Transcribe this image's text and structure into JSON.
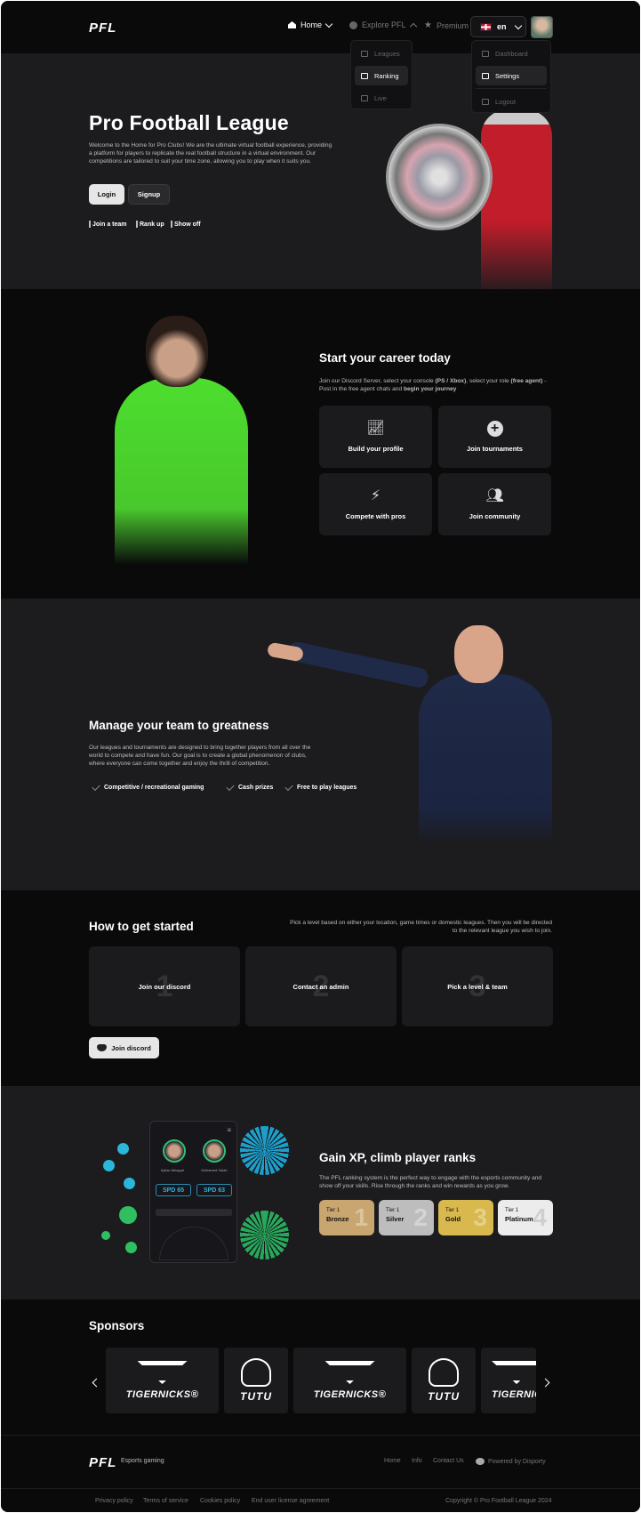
{
  "header": {
    "logo": "PFL",
    "nav": {
      "home": "Home",
      "explore": "Explore PFL",
      "premium": "Premium",
      "lang": "en"
    },
    "explore_menu": [
      "Leagues",
      "Ranking",
      "Live"
    ],
    "user_menu": [
      "Dashboard",
      "Settings",
      "Logout"
    ]
  },
  "hero": {
    "title": "Pro Football League",
    "description": "Welcome to the Home for Pro Clubs! We are the ultimate virtual football experience, providing a platform for players to replicate the real football structure in a virtual environment. Our competitions are tailored to suit your time zone, allowing you to play when it suits you.",
    "login": "Login",
    "signup": "Signup",
    "tags": [
      "Join a team",
      "Rank up",
      "Show off"
    ]
  },
  "career": {
    "title": "Start your career today",
    "text_a": "Join our Discord Server, select your console ",
    "text_b": "(PS / Xbox)",
    "text_c": ", select your role ",
    "text_d": "(free agent)",
    "text_e": " - Post in the free agent chats and ",
    "text_f": "begin your journey",
    "cards": [
      "Build your profile",
      "Join tournaments",
      "Compete with pros",
      "Join community"
    ]
  },
  "team": {
    "title": "Manage your team to greatness",
    "description": "Our leagues and tournaments are designed to bring together players from all over the world to compete and have fun. Our goal is to create a global phenomenon of clubs, where everyone can come together and enjoy the thrill of competition.",
    "checks": [
      "Competitive / recreational gaming",
      "Cash prizes",
      "Free to play leagues"
    ]
  },
  "how": {
    "title": "How to get started",
    "description": "Pick a level based on either your location, game times or domestic leagues. Then you will be directed to the relevant league you wish to join.",
    "steps": [
      {
        "num": "1",
        "label": "Join our discord"
      },
      {
        "num": "2",
        "label": "Contact an admin"
      },
      {
        "num": "3",
        "label": "Pick a level & team"
      }
    ],
    "button": "Join discord"
  },
  "xp": {
    "title": "Gain XP, climb player ranks",
    "description": "The PFL ranking system is the perfect way to engage with the esports community and show off your skills. Rise through the ranks and win rewards as you grow.",
    "phone": {
      "p1": "Kylian Mbappé",
      "p2": "Mohamed Salah",
      "s1": "SPD 65",
      "s2": "SPD 63"
    },
    "tiers": [
      {
        "tier": "Tier 1",
        "name": "Bronze",
        "num": "1",
        "color": "#c9a56f"
      },
      {
        "tier": "Tier 1",
        "name": "Silver",
        "num": "2",
        "color": "#bdbdbd"
      },
      {
        "tier": "Tier 1",
        "name": "Gold",
        "num": "3",
        "color": "#d9b84e"
      },
      {
        "tier": "Tier 1",
        "name": "Platinum",
        "num": "4",
        "color": "#ececec"
      }
    ]
  },
  "sponsors": {
    "title": "Sponsors",
    "items": [
      "TIGERNICKS®",
      "TUTU",
      "TIGERNICKS®",
      "TUTU",
      "TIGERNICKS®"
    ]
  },
  "footer": {
    "logo": "PFL",
    "tagline": "Esports gaming",
    "links": [
      "Home",
      "Info",
      "Contact Us"
    ],
    "powered": "Powered by Disporty",
    "legal": [
      "Privacy policy",
      "Terms of service",
      "Cookies policy",
      "End user license agreement"
    ],
    "copyright": "Copyright © Pro Football League 2024"
  }
}
